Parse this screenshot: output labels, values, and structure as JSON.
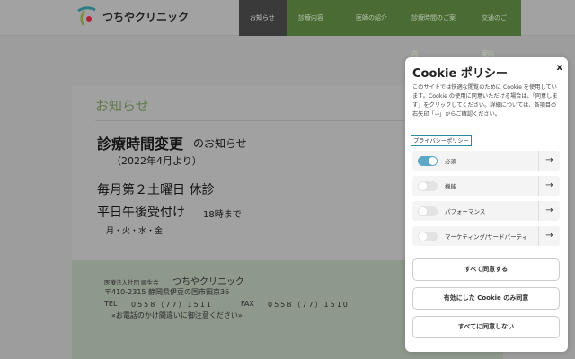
{
  "header": {
    "logo_text": "つちやクリニック",
    "nav": [
      "お知らせ",
      "診療内容",
      "医師の紹介",
      "診療時間のご案内",
      "交通のご案内"
    ]
  },
  "notice": {
    "section_title": "お知らせ",
    "headline_bold": "診療時間変更",
    "headline_suffix": "のお知らせ",
    "since": "（2022年4月より）",
    "line1": "毎月第２土曜日 休診",
    "line2_main": "平日午後受付け",
    "line2_sub": "18時まで",
    "days": "月・火・水・金"
  },
  "footer": {
    "org": "医療法人社団 順生会",
    "name": "つちやクリニック",
    "address": "〒410-2315 静岡県伊豆の国市田京36",
    "tel_label": "TEL",
    "tel": "0558（77）1511",
    "fax_label": "FAX",
    "fax": "0558（77）1510",
    "note": "«お電話のかけ間違いに御注意ください»"
  },
  "cookie": {
    "title": "Cookie ポリシー",
    "close": "x",
    "description": "このサイトでは快適な閲覧のために Cookie を使用しています。Cookie の使用に同意いただける場合は、「同意します」をクリックしてください。詳細については、各項目の右矢印「→」からご確認ください。",
    "privacy_link": "プライバシーポリシー",
    "categories": [
      {
        "label": "必須",
        "enabled": true
      },
      {
        "label": "機能",
        "enabled": false
      },
      {
        "label": "パフォーマンス",
        "enabled": false
      },
      {
        "label": "マーケティング/サードパーティ",
        "enabled": false
      }
    ],
    "arrow": "→",
    "buttons": {
      "accept_all": "すべて同意する",
      "accept_selected": "有効にした Cookie のみ同意",
      "reject_all": "すべてに同意しない"
    }
  },
  "colors": {
    "nav_green": "#4a6b34",
    "accent_toggle": "#5da8c8"
  }
}
